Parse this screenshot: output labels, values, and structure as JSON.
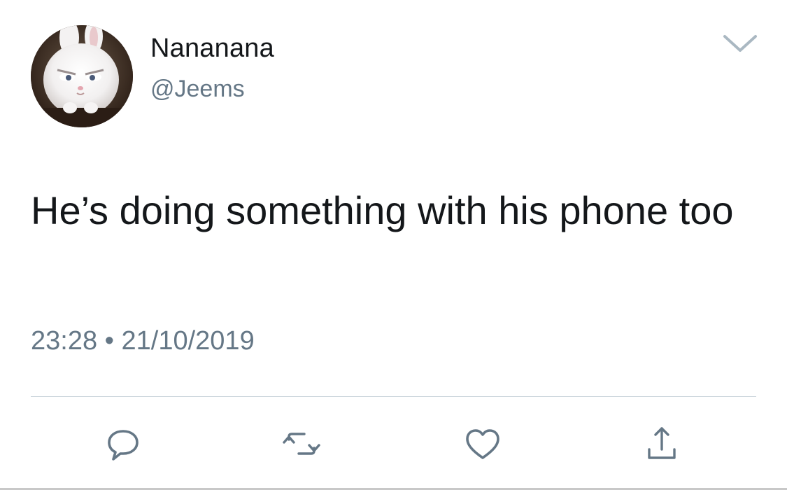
{
  "tweet": {
    "author": {
      "display_name": "Nananana",
      "handle": "@Jeems",
      "avatar_icon": "white-bunny-avatar"
    },
    "text": "He’s doing something with his phone too",
    "time": "23:28",
    "separator": " • ",
    "date": "21/10/2019",
    "menu_icon": "chevron-down-icon"
  },
  "actions": [
    {
      "name": "reply",
      "icon": "speech-bubble-icon"
    },
    {
      "name": "retweet",
      "icon": "retweet-arrows-icon"
    },
    {
      "name": "like",
      "icon": "heart-icon"
    },
    {
      "name": "share",
      "icon": "share-upload-icon"
    }
  ],
  "colors": {
    "text_primary": "#14171a",
    "text_secondary": "#657786",
    "icon": "#657786",
    "divider": "#ccd6dd"
  }
}
